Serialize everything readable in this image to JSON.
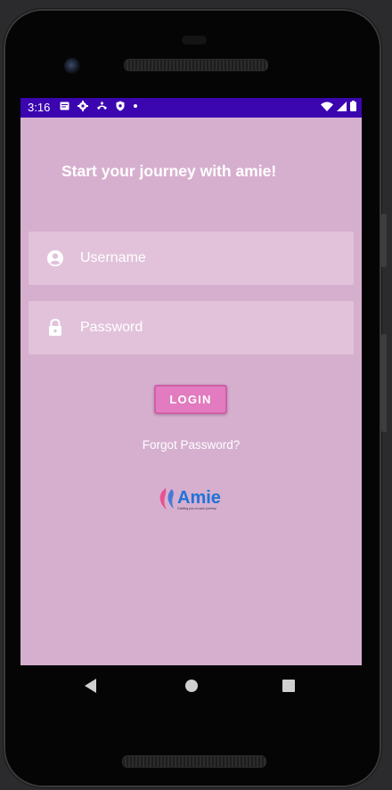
{
  "status_bar": {
    "time": "3:16",
    "left_icons": [
      "notification-icon",
      "settings-icon",
      "call-icon",
      "shield-icon",
      "dot-icon"
    ],
    "right_icons": [
      "wifi-icon",
      "signal-icon",
      "battery-icon"
    ]
  },
  "login_screen": {
    "title": "Start your journey with amie!",
    "username_placeholder": "Username",
    "password_placeholder": "Password",
    "login_label": "LOGIN",
    "forgot_password": "Forgot Password?"
  },
  "logo": {
    "name": "Amie",
    "tagline": "Guiding you on your journey"
  },
  "colors": {
    "status_bar": "#3b05b0",
    "background": "#d6afcf",
    "field": "#e2c2db",
    "button": "#e27bbf",
    "logo_text": "#1e73d8"
  },
  "nav_bar": [
    "back-icon",
    "home-icon",
    "recent-apps-icon"
  ]
}
